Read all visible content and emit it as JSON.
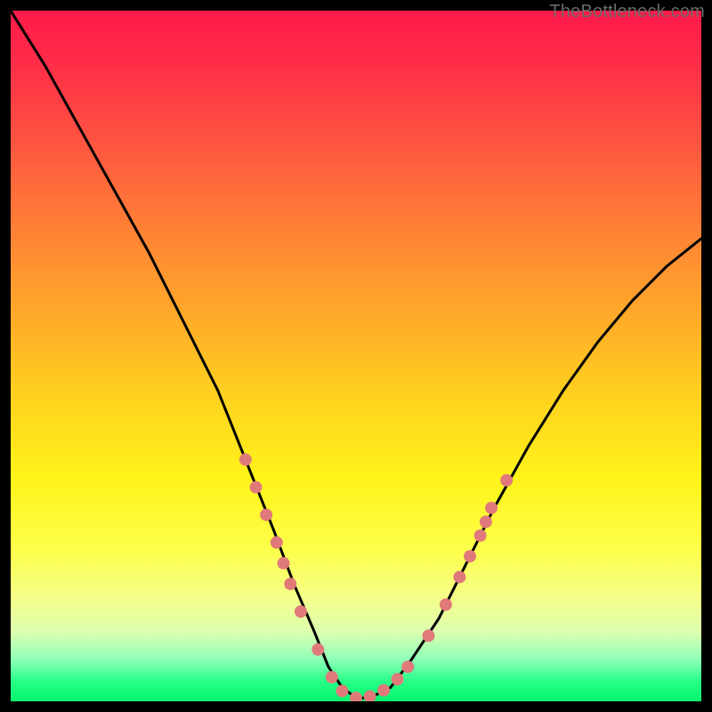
{
  "watermark": "TheBottleneck.com",
  "colors": {
    "frame": "#000000",
    "curve": "#000000",
    "marker": "#e07a7a",
    "gradient_stops": [
      "#ff1a4a",
      "#ff2e48",
      "#ff5840",
      "#ff8235",
      "#ffa92a",
      "#ffd21f",
      "#fff41a",
      "#fdff4a",
      "#f5ff8a",
      "#dcffb0",
      "#8cffb8",
      "#2aff88",
      "#03f56e"
    ]
  },
  "chart_data": {
    "type": "line",
    "title": "",
    "xlabel": "",
    "ylabel": "",
    "x_range": [
      0,
      100
    ],
    "y_range": [
      0,
      100
    ],
    "legend": false,
    "grid": false,
    "series": [
      {
        "name": "bottleneck-curve",
        "x": [
          0,
          5,
          10,
          15,
          20,
          25,
          30,
          34,
          38,
          41,
          44,
          46,
          48,
          50,
          52,
          55,
          58,
          62,
          66,
          70,
          75,
          80,
          85,
          90,
          95,
          100
        ],
        "y": [
          100,
          92,
          83,
          74,
          65,
          55,
          45,
          35,
          25,
          17,
          10,
          5,
          2,
          0.5,
          0.5,
          2,
          6,
          12,
          20,
          28,
          37,
          45,
          52,
          58,
          63,
          67
        ]
      }
    ],
    "markers": [
      {
        "x": 34.0,
        "y": 35.0
      },
      {
        "x": 35.5,
        "y": 31.0
      },
      {
        "x": 37.0,
        "y": 27.0
      },
      {
        "x": 38.5,
        "y": 23.0
      },
      {
        "x": 39.5,
        "y": 20.0
      },
      {
        "x": 40.5,
        "y": 17.0
      },
      {
        "x": 42.0,
        "y": 13.0
      },
      {
        "x": 44.5,
        "y": 7.5
      },
      {
        "x": 46.5,
        "y": 3.5
      },
      {
        "x": 48.0,
        "y": 1.5
      },
      {
        "x": 50.0,
        "y": 0.5
      },
      {
        "x": 52.0,
        "y": 0.7
      },
      {
        "x": 54.0,
        "y": 1.6
      },
      {
        "x": 56.0,
        "y": 3.2
      },
      {
        "x": 57.5,
        "y": 5.0
      },
      {
        "x": 60.5,
        "y": 9.5
      },
      {
        "x": 63.0,
        "y": 14.0
      },
      {
        "x": 65.0,
        "y": 18.0
      },
      {
        "x": 66.5,
        "y": 21.0
      },
      {
        "x": 68.0,
        "y": 24.0
      },
      {
        "x": 68.8,
        "y": 26.0
      },
      {
        "x": 69.6,
        "y": 28.0
      },
      {
        "x": 71.8,
        "y": 32.0
      }
    ]
  }
}
